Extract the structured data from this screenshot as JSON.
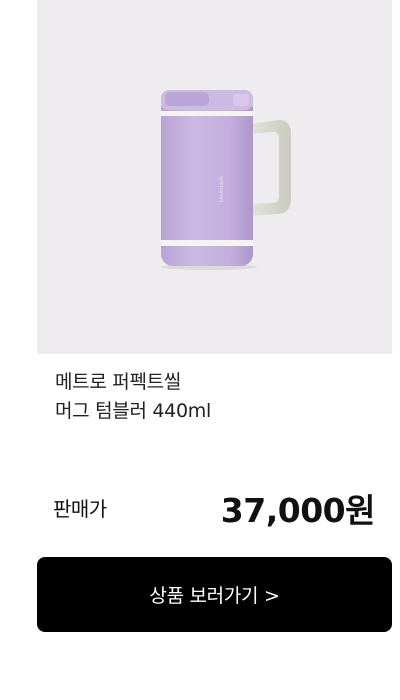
{
  "product": {
    "name_line1": "메트로 퍼펙트씰",
    "name_line2": "머그 텀블러 440ml",
    "price_label": "판매가",
    "price": "37,000원",
    "image_icon": "lavender-tumbler-mug-photo",
    "brand_mark": "LocknLock",
    "colors": {
      "body": "#c6b2df",
      "handle": "#d9dbcf",
      "background": "#eeecee"
    }
  },
  "cta": {
    "label": "상품 보러가기 >"
  }
}
